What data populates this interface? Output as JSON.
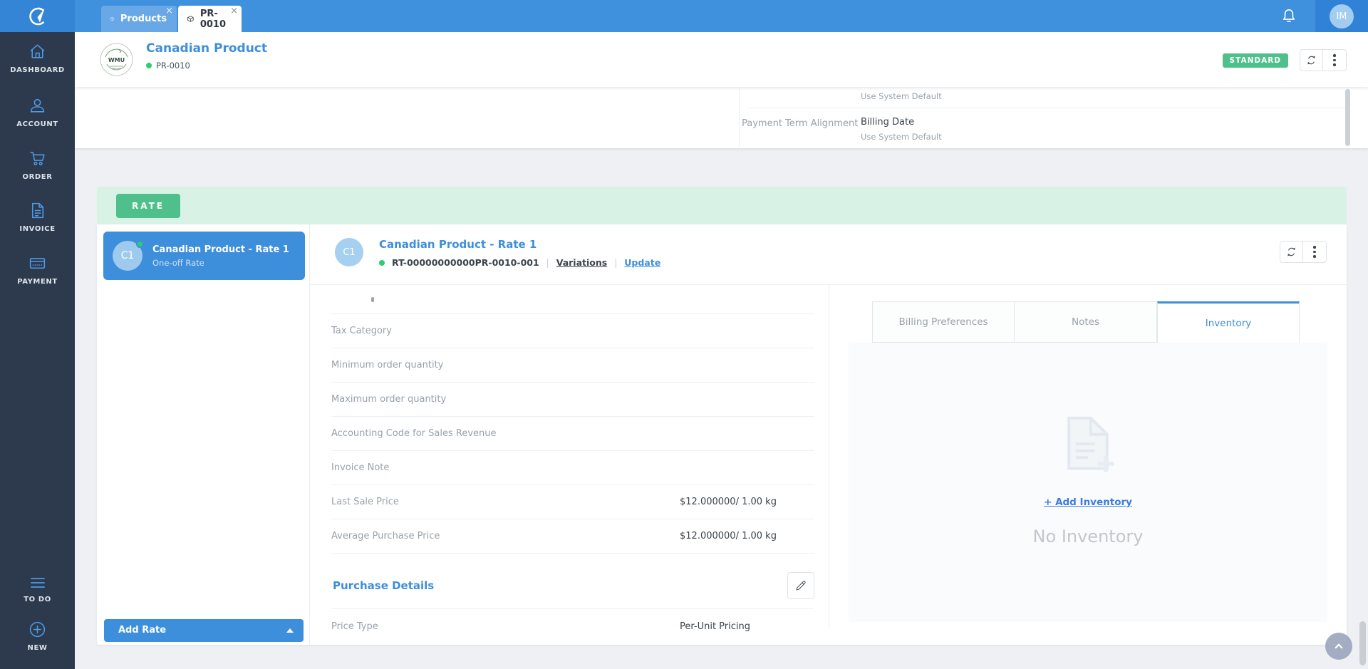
{
  "topbar": {
    "tabs": [
      {
        "label": "Products",
        "close": "×"
      },
      {
        "label": "PR-0010",
        "close": "×"
      }
    ]
  },
  "user": {
    "initials": "IM"
  },
  "sidebar": {
    "items": [
      {
        "label": "DASHBOARD",
        "icon": "home-icon"
      },
      {
        "label": "ACCOUNT",
        "icon": "person-icon"
      },
      {
        "label": "ORDER",
        "icon": "cart-icon"
      },
      {
        "label": "INVOICE",
        "icon": "invoice-icon"
      },
      {
        "label": "PAYMENT",
        "icon": "credit-card-icon"
      }
    ],
    "bottom_items": [
      {
        "label": "TO DO",
        "icon": "list-icon"
      },
      {
        "label": "NEW",
        "icon": "plus-circle-icon"
      }
    ]
  },
  "product_header": {
    "title": "Canadian Product",
    "code": "PR-0010",
    "logo_text": "WMU",
    "badge": "STANDARD"
  },
  "settings_peek": {
    "row_above_hint": "Use System Default",
    "label": "Payment Term Alignment",
    "value": "Billing Date",
    "value_hint": "Use System Default"
  },
  "rate_section": {
    "banner": "RATE",
    "list": {
      "items": [
        {
          "avatar": "C1",
          "title": "Canadian Product - Rate 1",
          "subtitle": "One-off Rate"
        }
      ],
      "add_button": "Add Rate"
    },
    "detail": {
      "avatar": "C1",
      "title": "Canadian Product - Rate 1",
      "code": "RT-00000000000PR-0010-001",
      "sep": "|",
      "link_variations": "Variations",
      "link_update": "Update",
      "fields": [
        {
          "label": "Tax Category",
          "value": ""
        },
        {
          "label": "Minimum order quantity",
          "value": ""
        },
        {
          "label": "Maximum order quantity",
          "value": ""
        },
        {
          "label": "Accounting Code for Sales Revenue",
          "value": ""
        },
        {
          "label": "Invoice Note",
          "value": ""
        },
        {
          "label": "Last Sale Price",
          "value": "$12.000000/ 1.00 kg"
        },
        {
          "label": "Average Purchase Price",
          "value": "$12.000000/ 1.00 kg"
        }
      ],
      "purchase_heading": "Purchase Details",
      "purchase_fields": [
        {
          "label": "Price Type",
          "value": "Per-Unit Pricing"
        }
      ],
      "tabs": [
        {
          "label": "Billing Preferences"
        },
        {
          "label": "Notes"
        },
        {
          "label": "Inventory"
        }
      ],
      "inventory": {
        "add_link": "+ Add Inventory",
        "empty_message": "No Inventory"
      }
    }
  },
  "colors": {
    "topbar_blue": "#3f90dd",
    "sidebar_navy": "#2d3a4e",
    "accent_blue": "#3d8edb",
    "green": "#4fc08c",
    "status_green": "#2ecc71",
    "banner_green": "#d9f2e6"
  },
  "icons": {
    "logo": "company-logo-icon",
    "tab": "package-box-icon",
    "bell": "bell-icon",
    "refresh": "refresh-icon",
    "kebab": "kebab-menu-icon",
    "pencil": "pencil-icon",
    "empty": "document-plus-icon",
    "scroll_top": "chevron-up-icon"
  }
}
